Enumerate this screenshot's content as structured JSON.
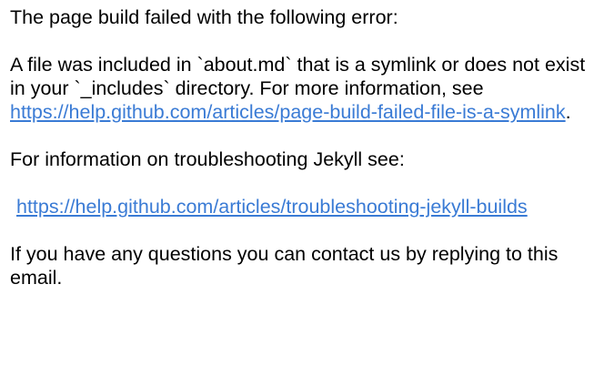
{
  "email": {
    "intro": "The page build failed with the following error:",
    "error": {
      "text_before_link": "A file was included in `about.md` that is a symlink or does not exist in your `_includes` directory. For more information, see ",
      "link_text": "https://help.github.com/articles/page-build-failed-file-is-a-symlink",
      "text_after_link": "."
    },
    "troubleshooting": {
      "label": "For information on troubleshooting Jekyll see:",
      "link_text": "https://help.github.com/articles/troubleshooting-jekyll-builds"
    },
    "closing": "If you have any questions you can contact us by replying to this email."
  },
  "colors": {
    "link": "#3a7bd5",
    "text": "#000000",
    "background": "#ffffff"
  }
}
